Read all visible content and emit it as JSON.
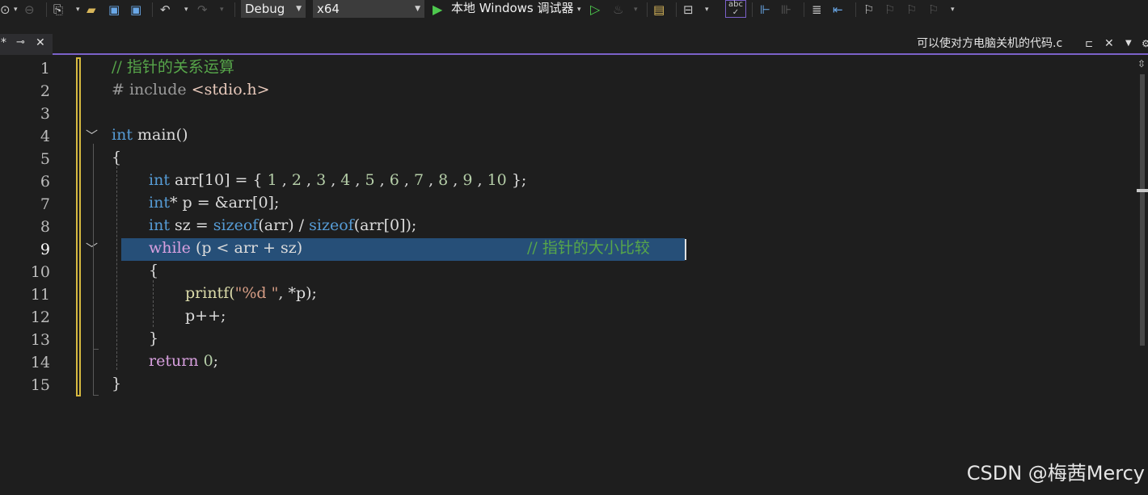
{
  "toolbar": {
    "config_value": "Debug",
    "platform_value": "x64",
    "run_label": "本地 Windows 调试器"
  },
  "tabs": {
    "active_tab_marker": "*",
    "right_tab_title": "可以使对方电脑关机的代码.c"
  },
  "editor": {
    "line_numbers": [
      "1",
      "2",
      "3",
      "4",
      "5",
      "6",
      "7",
      "8",
      "9",
      "10",
      "11",
      "12",
      "13",
      "14",
      "15"
    ],
    "current_line": 9,
    "lines": {
      "l1_comment": "// 指针的关系运算",
      "l2_hash": "# ",
      "l2_include": "include ",
      "l2_header": "<stdio.h>",
      "l4_int": "int",
      "l4_main": " main()",
      "l5": "{",
      "l6_int": "int",
      "l6_decl": " arr[10] = { ",
      "l6_nums": [
        "1",
        "2",
        "3",
        "4",
        "5",
        "6",
        "7",
        "8",
        "9",
        "10"
      ],
      "l6_end": " };",
      "l7_int": "int",
      "l7_rest": "* p = &arr[0];",
      "l8_int": "int",
      "l8_sz": " sz = ",
      "l8_sizeof1": "sizeof",
      "l8_mid": "(arr) / ",
      "l8_sizeof2": "sizeof",
      "l8_end": "(arr[0]);",
      "l9_while": "while",
      "l9_cond": " (p < arr + sz)",
      "l9_comment": "// 指针的大小比较",
      "l10": "{",
      "l11_fn": "printf(",
      "l11_str": "\"%d \"",
      "l11_rest": ", *p);",
      "l12": "p++;",
      "l13": "}",
      "l14_return": "return",
      "l14_sp": " ",
      "l14_zero": "0",
      "l14_semi": ";",
      "l15": "}"
    }
  },
  "watermark": "CSDN @梅茜Mercy"
}
